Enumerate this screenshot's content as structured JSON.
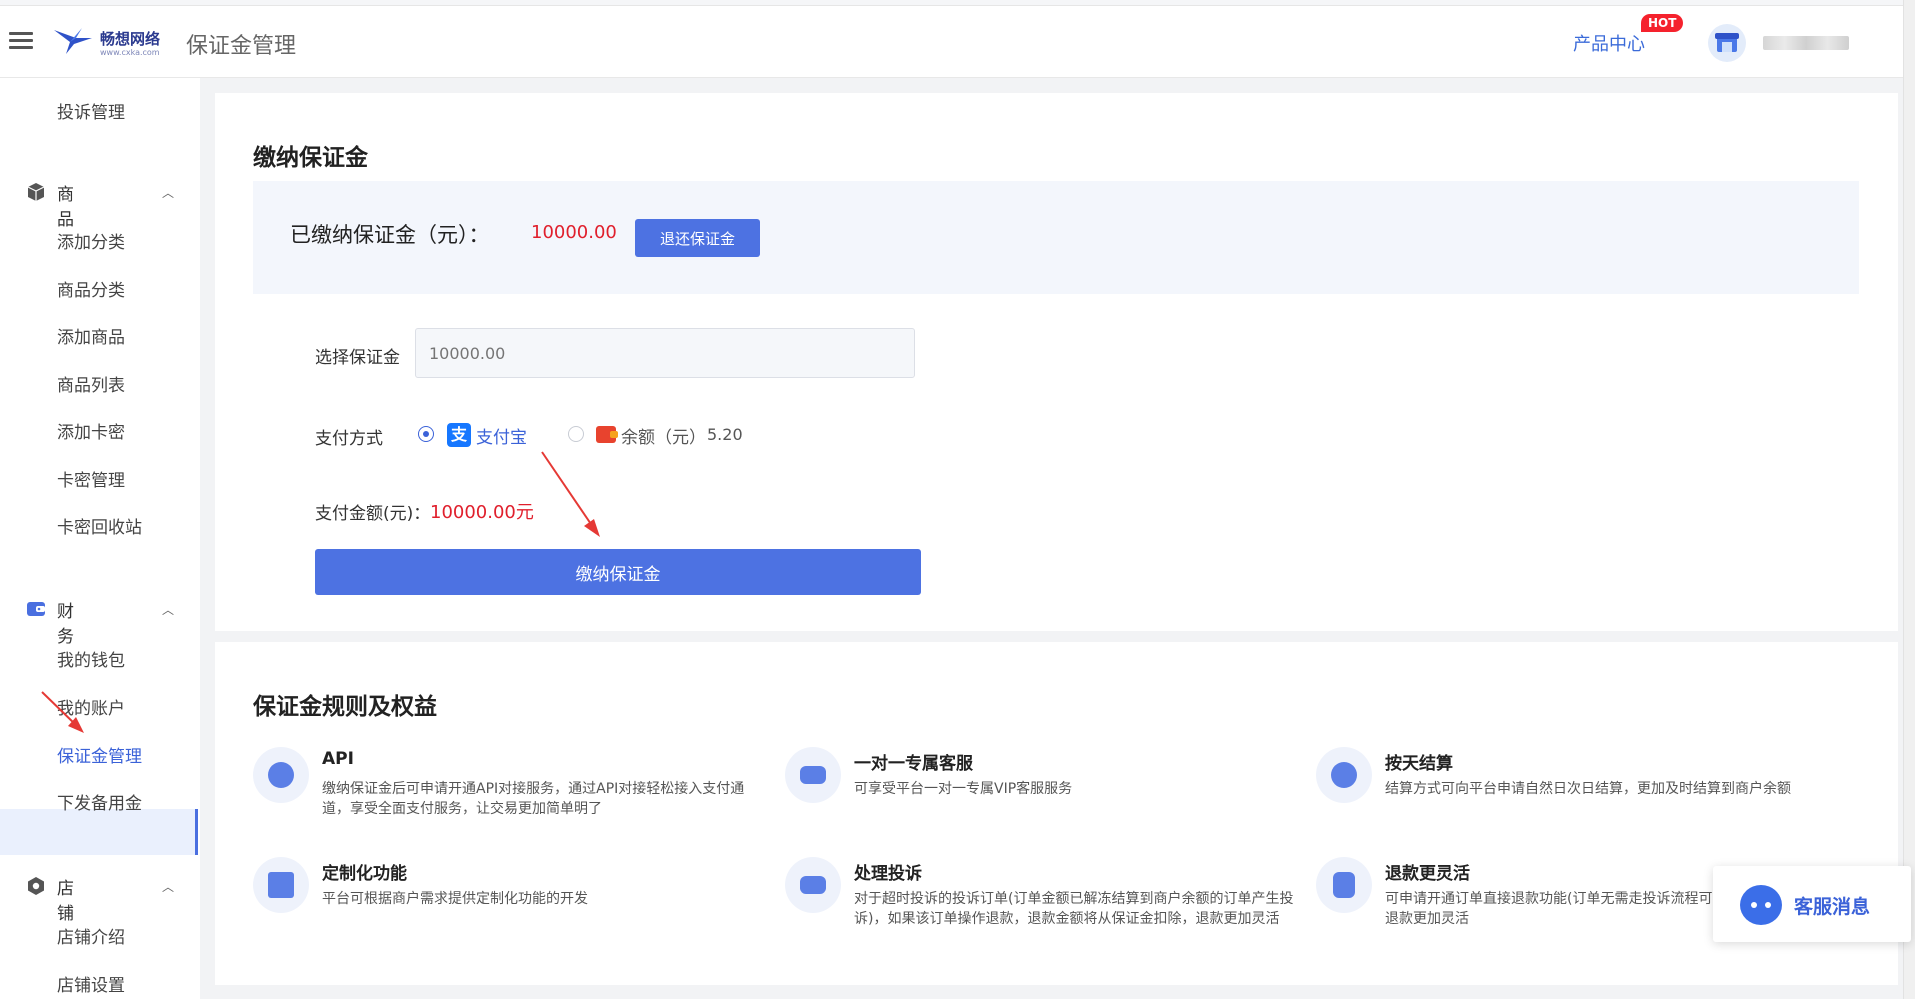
{
  "header": {
    "logo_text": "畅想网络",
    "logo_sub": "www.cxka.com",
    "page_title": "保证金管理",
    "product_center": "产品中心",
    "hot_badge": "HOT"
  },
  "sidebar": {
    "top_item": "投诉管理",
    "groups": [
      {
        "label": "商品",
        "items": [
          "添加分类",
          "商品分类",
          "添加商品",
          "商品列表",
          "添加卡密",
          "卡密管理",
          "卡密回收站"
        ]
      },
      {
        "label": "财务",
        "items": [
          "我的钱包",
          "我的账户",
          "保证金管理",
          "下发备用金"
        ]
      },
      {
        "label": "店铺",
        "items": [
          "店铺介绍",
          "店铺设置"
        ]
      }
    ],
    "active_item": "保证金管理"
  },
  "deposit": {
    "title": "缴纳保证金",
    "paid_label": "已缴纳保证金（元）：",
    "paid_value": "10000.00",
    "refund_button": "退还保证金",
    "select_label": "选择保证金",
    "select_placeholder": "10000.00",
    "pay_method_label": "支付方式",
    "alipay_label": "支付宝",
    "balance_label": "余额（元）",
    "balance_value": "5.20",
    "selected_method": "alipay",
    "pay_amount_label": "支付金额(元)：",
    "pay_amount_value": "10000.00元",
    "pay_button": "缴纳保证金"
  },
  "rules": {
    "title": "保证金规则及权益",
    "items": [
      {
        "title": "API",
        "desc": "缴纳保证金后可申请开通API对接服务，通过API对接轻松接入支付通道，享受全面支付服务，让交易更加简单明了",
        "icon": "api-icon"
      },
      {
        "title": "一对一专属客服",
        "desc": "可享受平台一对一专属VIP客服服务",
        "icon": "customer-service-icon"
      },
      {
        "title": "按天结算",
        "desc": "结算方式可向平台申请自然日次日结算，更加及时结算到商户余额",
        "icon": "yuan-icon"
      },
      {
        "title": "定制化功能",
        "desc": "平台可根据商户需求提供定制化功能的开发",
        "icon": "custom-feature-icon"
      },
      {
        "title": "处理投诉",
        "desc": "对于超时投诉的投诉订单(订单金额已解冻结算到商户余额的订单产生投诉)，如果该订单操作退款，退款金额将从保证金扣除，退款更加灵活",
        "icon": "complaint-icon"
      },
      {
        "title": "退款更灵活",
        "desc": "可申请开通订单直接退款功能(订单无需走投诉流程可直接操作退款)，退款更加灵活",
        "icon": "refund-icon"
      }
    ]
  },
  "customer_service": {
    "label": "客服消息"
  },
  "colors": {
    "accent": "#4d72e2",
    "danger": "#e01f2c",
    "active_bg": "#eaf0fd"
  }
}
